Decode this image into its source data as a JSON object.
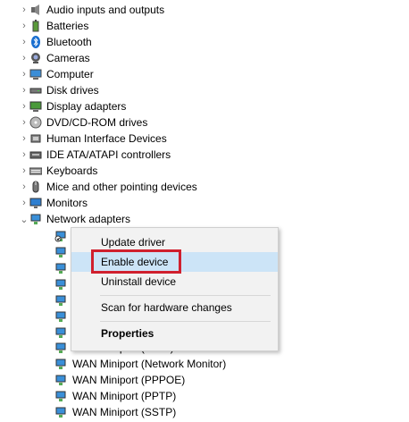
{
  "categories": [
    {
      "label": "Audio inputs and outputs",
      "icon": "speaker-icon"
    },
    {
      "label": "Batteries",
      "icon": "battery-icon"
    },
    {
      "label": "Bluetooth",
      "icon": "bluetooth-icon"
    },
    {
      "label": "Cameras",
      "icon": "camera-icon"
    },
    {
      "label": "Computer",
      "icon": "computer-icon"
    },
    {
      "label": "Disk drives",
      "icon": "disk-drive-icon"
    },
    {
      "label": "Display adapters",
      "icon": "display-adapter-icon"
    },
    {
      "label": "DVD/CD-ROM drives",
      "icon": "dvd-drive-icon"
    },
    {
      "label": "Human Interface Devices",
      "icon": "hid-icon"
    },
    {
      "label": "IDE ATA/ATAPI controllers",
      "icon": "ide-controller-icon"
    },
    {
      "label": "Keyboards",
      "icon": "keyboard-icon"
    },
    {
      "label": "Mice and other pointing devices",
      "icon": "mouse-icon"
    },
    {
      "label": "Monitors",
      "icon": "monitor-icon"
    },
    {
      "label": "Network adapters",
      "icon": "network-adapter-icon",
      "expanded": true
    }
  ],
  "network_children": [
    {
      "label": ""
    },
    {
      "label": ""
    },
    {
      "label": ""
    },
    {
      "label": ""
    },
    {
      "label": ""
    },
    {
      "label": ""
    },
    {
      "label": ""
    },
    {
      "label": "WAN Miniport (L2TP)"
    },
    {
      "label": "WAN Miniport (Network Monitor)"
    },
    {
      "label": "WAN Miniport (PPPOE)"
    },
    {
      "label": "WAN Miniport (PPTP)"
    },
    {
      "label": "WAN Miniport (SSTP)"
    }
  ],
  "context_menu": {
    "update_driver": "Update driver",
    "enable_device": "Enable device",
    "uninstall_device": "Uninstall device",
    "scan": "Scan for hardware changes",
    "properties": "Properties"
  },
  "colors": {
    "highlight": "#cce4f7",
    "callout": "#d0202e"
  }
}
